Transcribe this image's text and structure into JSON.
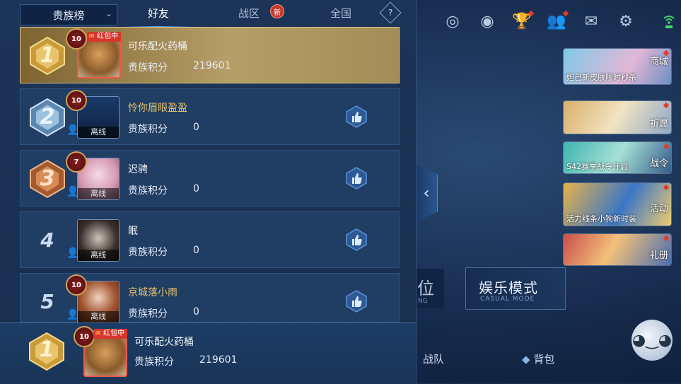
{
  "tabs": {
    "dropdown_label": "贵族榜",
    "friends": "好友",
    "region": "战区",
    "region_badge": "新",
    "national": "全国",
    "help": "?"
  },
  "ranking": [
    {
      "rank": "1",
      "name": "可乐配火药桶",
      "score_label": "贵族积分",
      "score": "219601",
      "level": "10",
      "tag": "红包中",
      "status": "",
      "name_color": "white"
    },
    {
      "rank": "2",
      "name": "怜你眉眼盈盈",
      "score_label": "贵族积分",
      "score": "0",
      "level": "10",
      "tag": "",
      "status": "离线",
      "name_color": "gold"
    },
    {
      "rank": "3",
      "name": "迟骋",
      "score_label": "贵族积分",
      "score": "0",
      "level": "7",
      "tag": "",
      "status": "离线",
      "name_color": "white"
    },
    {
      "rank": "4",
      "name": "眠",
      "score_label": "贵族积分",
      "score": "0",
      "level": "",
      "tag": "",
      "status": "离线",
      "name_color": "white"
    },
    {
      "rank": "5",
      "name": "京城落小雨",
      "score_label": "贵族积分",
      "score": "0",
      "level": "10",
      "tag": "",
      "status": "离线",
      "name_color": "gold"
    }
  ],
  "my_rank": {
    "rank": "1",
    "name": "可乐配火药桶",
    "score_label": "贵族积分",
    "score": "219601",
    "level": "10",
    "tag": "红包中"
  },
  "side_cards": [
    {
      "caption": "妲己新皮肤限时秒杀",
      "tag": "商城"
    },
    {
      "caption": "",
      "tag": "祈愿"
    },
    {
      "caption": "S42赛季战令开启",
      "tag": "战令"
    },
    {
      "caption": "活力线条小狗新时装",
      "tag": "活动"
    },
    {
      "caption": "",
      "tag": "礼册"
    }
  ],
  "mode": {
    "title": "娱乐模式",
    "subtitle": "CASUAL MODE",
    "rank_fragment": "位",
    "rank_sub": "NG"
  },
  "bottom_nav": {
    "team": "战队",
    "bag": "背包"
  },
  "colors": {
    "gold_row": "#b79e68",
    "panel": "#1c3457",
    "accent": "#5fa6ff"
  }
}
